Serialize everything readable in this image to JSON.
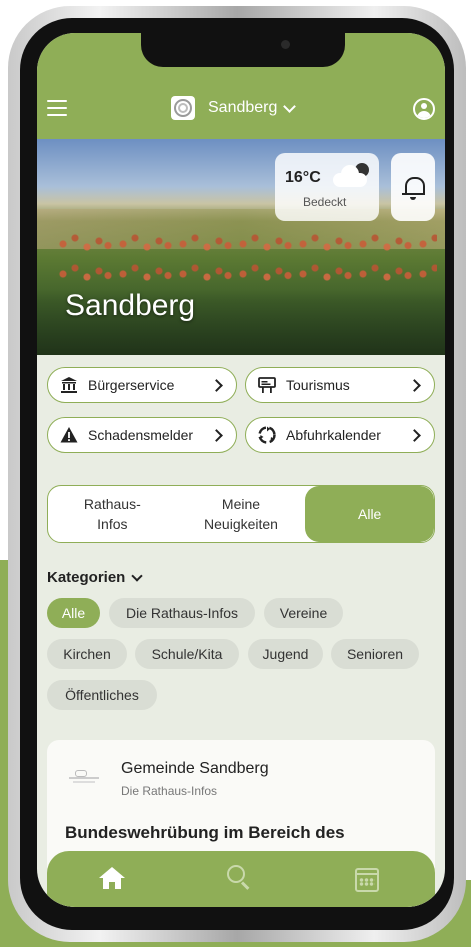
{
  "header": {
    "town": "Sandberg"
  },
  "hero": {
    "title": "Sandberg",
    "weather": {
      "temperature": "16°C",
      "description": "Bedeckt",
      "icon": "cloud-sun-icon"
    }
  },
  "quick_links": [
    {
      "label": "Bürgerservice",
      "icon": "townhall-icon"
    },
    {
      "label": "Tourismus",
      "icon": "sign-icon"
    },
    {
      "label": "Schadensmelder",
      "icon": "warning-icon"
    },
    {
      "label": "Abfuhrkalender",
      "icon": "recycle-icon"
    }
  ],
  "segments": {
    "items": [
      {
        "line1": "Rathaus-",
        "line2": "Infos"
      },
      {
        "line1": "Meine",
        "line2": "Neuigkeiten"
      },
      {
        "line1": "Alle",
        "line2": ""
      }
    ],
    "active": "Alle"
  },
  "categories": {
    "title": "Kategorien",
    "chips": [
      "Alle",
      "Die Rathaus-Infos",
      "Vereine",
      "Kirchen",
      "Schule/Kita",
      "Jugend",
      "Senioren",
      "Öffentliches"
    ],
    "active": "Alle"
  },
  "news": {
    "source": "Gemeinde Sandberg",
    "category": "Die Rathaus-Infos",
    "headline": "Bundeswehrübung im Bereich des"
  },
  "tabbar": {
    "items": [
      "home-icon",
      "search-icon",
      "calendar-icon"
    ],
    "active": "home-icon"
  },
  "colors": {
    "primary": "#8fae57",
    "background": "#e9ede3",
    "chip": "#d9ddd4"
  }
}
